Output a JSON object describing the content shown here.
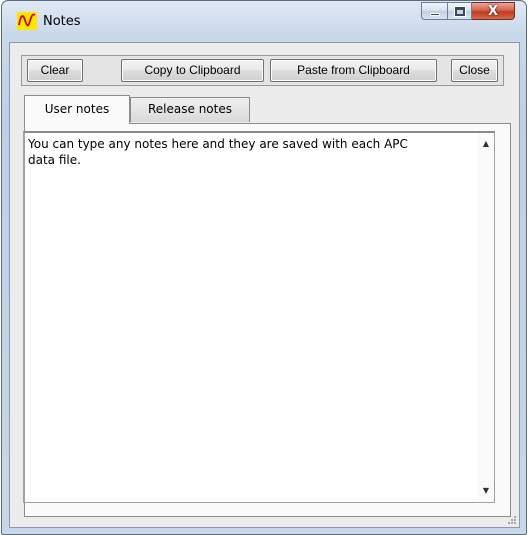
{
  "window": {
    "title": "Notes",
    "icon": "waveform-icon",
    "colors": {
      "icon_bg": "#ffe600",
      "icon_wave": "#d40000",
      "close_button": "#c4391f"
    }
  },
  "caption": {
    "minimize_icon": "minimize-icon",
    "maximize_icon": "maximize-icon",
    "close_glyph": "X"
  },
  "toolbar": {
    "clear_label": "Clear",
    "copy_label": "Copy to Clipboard",
    "paste_label": "Paste from Clipboard",
    "close_label": "Close"
  },
  "tabs": [
    {
      "label": "User notes",
      "active": true
    },
    {
      "label": "Release notes",
      "active": false
    }
  ],
  "editor": {
    "text": "You can type any notes here and they are saved with each APC\ndata file."
  }
}
